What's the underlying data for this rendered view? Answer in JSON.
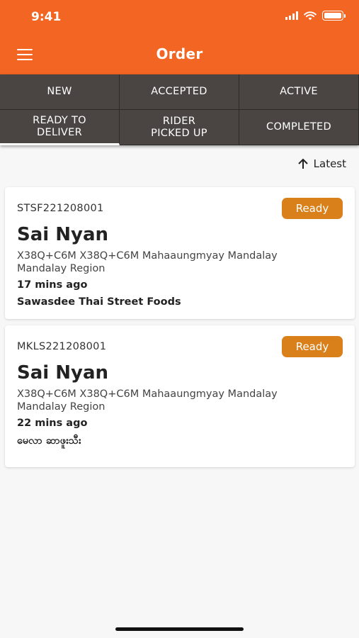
{
  "status_bar": {
    "time": "9:41"
  },
  "header": {
    "title": "Order",
    "menu_icon": "hamburger-menu-icon"
  },
  "tabs": [
    {
      "label": "NEW"
    },
    {
      "label": "ACCEPTED"
    },
    {
      "label": "ACTIVE"
    },
    {
      "label": "READY TO\nDELIVER",
      "selected": true
    },
    {
      "label": "RIDER\nPICKED UP"
    },
    {
      "label": "COMPLETED"
    }
  ],
  "sort": {
    "label": "Latest",
    "icon": "arrow-up-icon"
  },
  "orders": [
    {
      "code": "STSF221208001",
      "status": "Ready",
      "customer": "Sai Nyan",
      "address": "X38Q+C6M X38Q+C6M  Mahaaungmyay Mandalay Mandalay Region",
      "time_ago": "17 mins ago",
      "shop": "Sawasdee Thai Street Foods"
    },
    {
      "code": "MKLS221208001",
      "status": "Ready",
      "customer": "Sai Nyan",
      "address": "X38Q+C6M X38Q+C6M  Mahaaungmyay Mandalay Mandalay Region",
      "time_ago": "22 mins ago",
      "shop": "မေလာ ဆာဖူးသီး"
    }
  ],
  "colors": {
    "header": "#f26522",
    "tabs": "#4a4542",
    "badge": "#d9801a"
  }
}
